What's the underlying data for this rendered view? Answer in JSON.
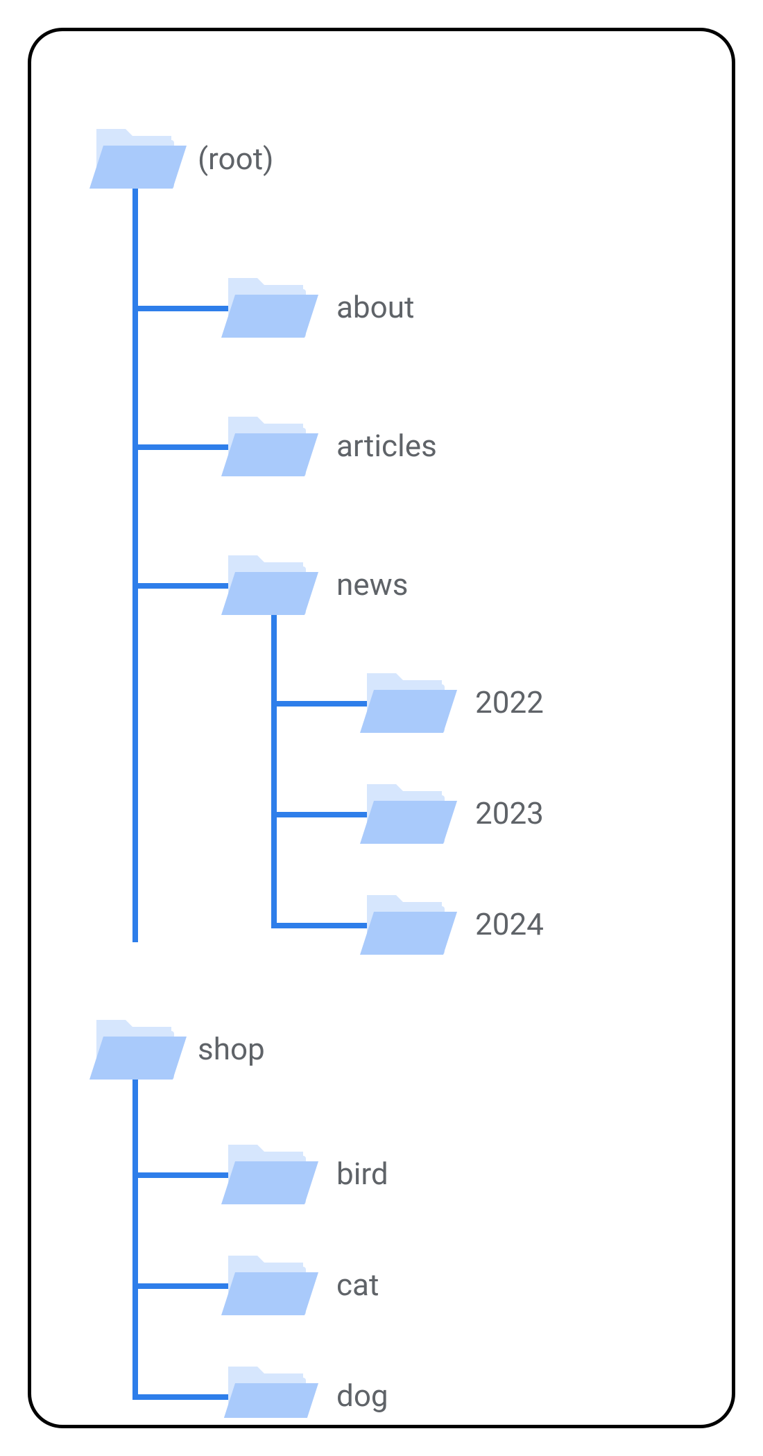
{
  "tree": {
    "root_label": "(root)",
    "root_children": [
      {
        "label": "about"
      },
      {
        "label": "articles"
      },
      {
        "label": "news",
        "children": [
          {
            "label": "2022"
          },
          {
            "label": "2023"
          },
          {
            "label": "2024"
          }
        ]
      }
    ],
    "shop_label": "shop",
    "shop_children": [
      {
        "label": "bird"
      },
      {
        "label": "cat"
      },
      {
        "label": "dog"
      }
    ]
  },
  "colors": {
    "line": "#2e7eea",
    "folder_body": "#a9cafb",
    "folder_tab": "#d6e6fd",
    "text": "#5f6368"
  }
}
